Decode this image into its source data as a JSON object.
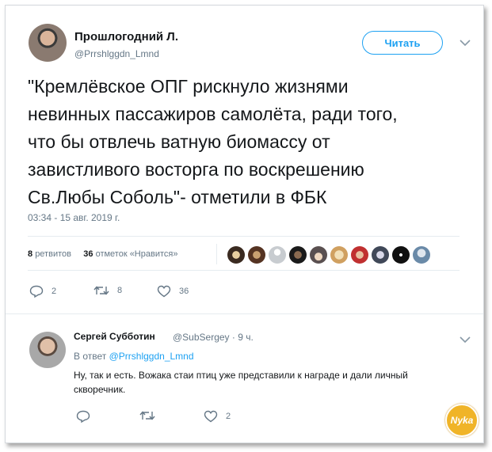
{
  "author": {
    "name": "Прошлогодний Л.",
    "handle": "@Prrshlggdn_Lmnd"
  },
  "follow_button": "Читать",
  "tweet": {
    "text": "\"Кремлёвское ОПГ рискнуло жизнями\nневинных пассажиров самолёта, ради того,\nчто бы отвлечь ватную биомассу от\nзавистливого восторга по воскрешению\nСв.Любы Соболь\"-   отметили в ФБК",
    "timestamp": "03:34 - 15 авг. 2019 г."
  },
  "stats": {
    "retweets_count": "8",
    "retweets_label": "ретвитов",
    "likes_count": "36",
    "likes_label": "отметок «Нравится»"
  },
  "actions": {
    "replies": "2",
    "retweets": "8",
    "likes": "36"
  },
  "reply": {
    "name": "Сергей Субботин",
    "handle": "@SubSergey · 9 ч.",
    "replying_prefix": "В ответ",
    "replying_to": "@Prrshlggdn_Lmnd",
    "text": "Ну, так и есть. Вожака стаи птиц уже представили к награде и дали личный скворечник.",
    "actions": {
      "replies": "",
      "retweets": "",
      "likes": "2"
    }
  },
  "watermark": "Nyka",
  "colors": {
    "accent": "#1da1f2",
    "text": "#14171a",
    "secondary": "#657786"
  }
}
